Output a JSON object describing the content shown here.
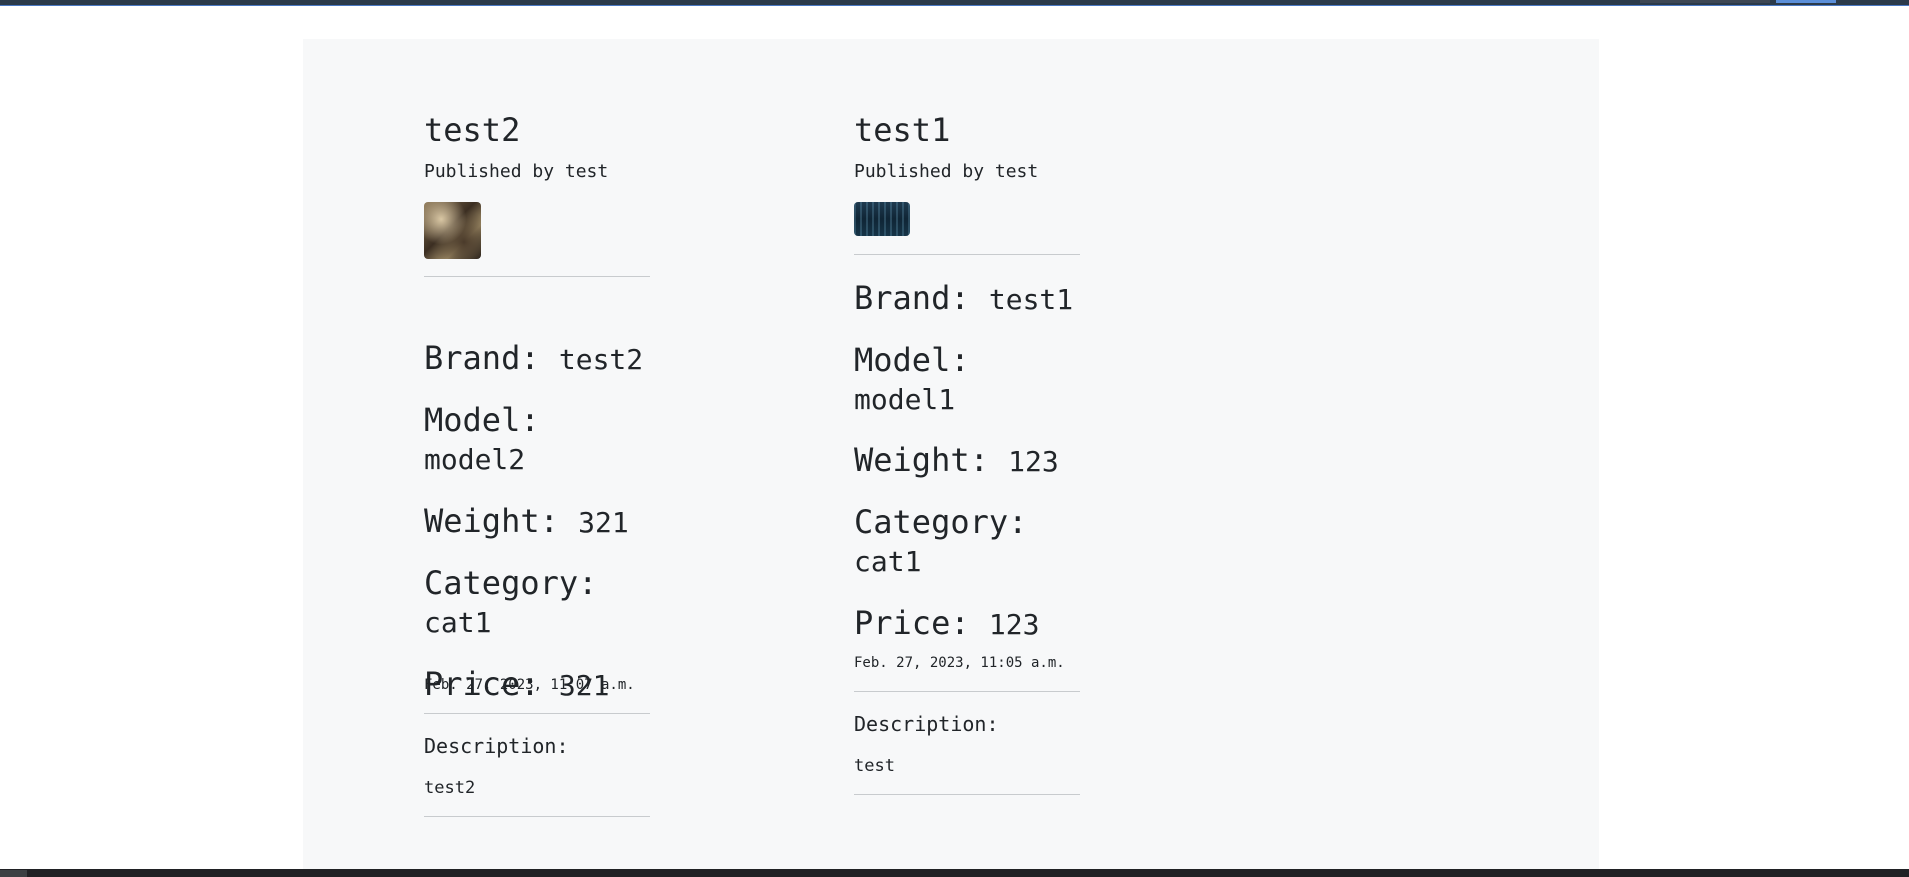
{
  "products": [
    {
      "title": "test2",
      "published_by": "Published by test",
      "image_alt": "product-photo",
      "brand_label": "Brand:",
      "brand": "test2",
      "model_label": "Model:",
      "model": "model2",
      "weight_label": "Weight:",
      "weight": "321",
      "category_label": "Category:",
      "category": "cat1",
      "price_label": "Price:",
      "price": "321",
      "date": "Feb. 27, 2023, 11:07 a.m.",
      "description_label": "Description:",
      "description": "test2"
    },
    {
      "title": "test1",
      "published_by": "Published by test",
      "image_alt": "product-photo",
      "brand_label": "Brand:",
      "brand": "test1",
      "model_label": "Model:",
      "model": "model1",
      "weight_label": "Weight:",
      "weight": "123",
      "category_label": "Category:",
      "category": "cat1",
      "price_label": "Price:",
      "price": "123",
      "date": "Feb. 27, 2023, 11:05 a.m.",
      "description_label": "Description:",
      "description": "test"
    }
  ]
}
